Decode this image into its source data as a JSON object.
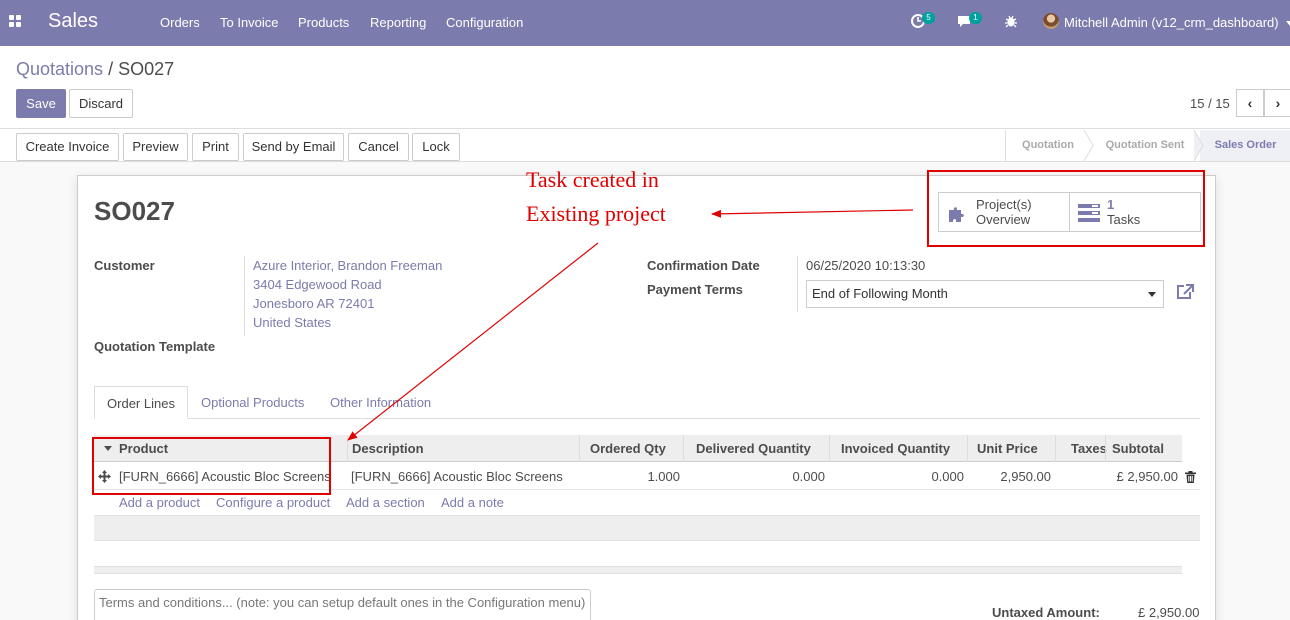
{
  "navbar": {
    "app_name": "Sales",
    "menu": [
      "Orders",
      "To Invoice",
      "Products",
      "Reporting",
      "Configuration"
    ],
    "activity_count": "5",
    "message_count": "1",
    "user": "Mitchell Admin (v12_crm_dashboard)",
    "color": "#7c7bad"
  },
  "breadcrumb": {
    "parent": "Quotations",
    "separator": "/",
    "current": "SO027"
  },
  "buttons": {
    "save": "Save",
    "discard": "Discard"
  },
  "pager": {
    "value": "15 / 15"
  },
  "actions": [
    "Create Invoice",
    "Preview",
    "Print",
    "Send by Email",
    "Cancel",
    "Lock"
  ],
  "status": [
    "Quotation",
    "Quotation Sent",
    "Sales Order"
  ],
  "status_active": "Sales Order",
  "record": {
    "name": "SO027",
    "smart_buttons": {
      "projects_line1": "Project(s)",
      "projects_line2": "Overview",
      "tasks_count": "1",
      "tasks_label": "Tasks"
    },
    "customer_label": "Customer",
    "customer_address": [
      "Azure Interior, Brandon Freeman",
      "3404 Edgewood Road",
      "Jonesboro AR 72401",
      "United States"
    ],
    "quotation_template_label": "Quotation Template",
    "confirmation_date_label": "Confirmation Date",
    "confirmation_date": "06/25/2020 10:13:30",
    "payment_terms_label": "Payment Terms",
    "payment_terms": "End of Following Month"
  },
  "tabs": [
    "Order Lines",
    "Optional Products",
    "Other Information"
  ],
  "table": {
    "columns": [
      "Product",
      "Description",
      "Ordered Qty",
      "Delivered Quantity",
      "Invoiced Quantity",
      "Unit Price",
      "Taxes",
      "Subtotal"
    ],
    "rows": [
      {
        "product": "[FURN_6666] Acoustic Bloc Screens",
        "description": "[FURN_6666] Acoustic Bloc Screens",
        "ordered_qty": "1.000",
        "delivered_qty": "0.000",
        "invoiced_qty": "0.000",
        "unit_price": "2,950.00",
        "taxes": "",
        "subtotal": "£ 2,950.00"
      }
    ],
    "add_links": [
      "Add a product",
      "Configure a product",
      "Add a section",
      "Add a note"
    ]
  },
  "terms_placeholder": "Terms and conditions... (note: you can setup default ones in the Configuration menu)",
  "totals": {
    "untaxed_label": "Untaxed Amount:",
    "untaxed_value": "£ 2,950.00"
  },
  "annotation": {
    "line1": "Task created in",
    "line2": "Existing project",
    "color": "#e00000"
  }
}
